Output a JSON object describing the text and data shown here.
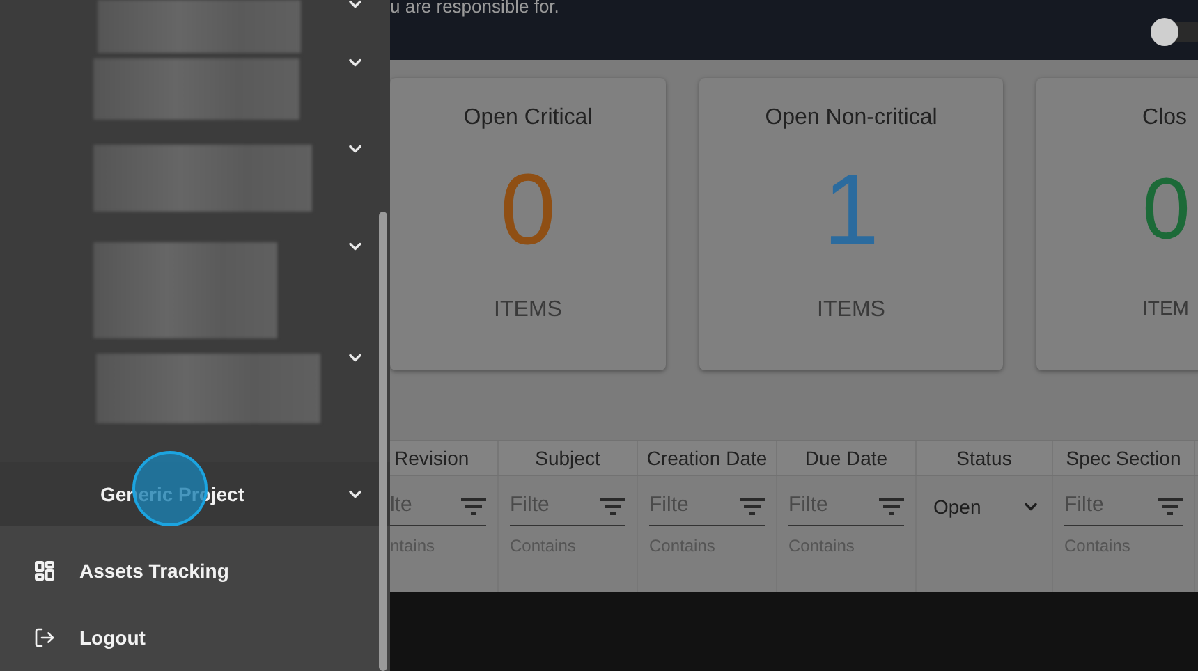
{
  "header": {
    "text": "u are responsible for.",
    "toggle": {
      "on": false
    }
  },
  "cards": [
    {
      "title": "Open Critical",
      "value": "0",
      "label": "ITEMS",
      "color": "#8f4f14"
    },
    {
      "title": "Open Non-critical",
      "value": "1",
      "label": "ITEMS",
      "color": "#2b6b9e"
    },
    {
      "title": "Clos",
      "value": "0",
      "label": "ITEM",
      "color": "#1c6a38"
    }
  ],
  "table": {
    "columns": [
      "Revision",
      "Subject",
      "Creation Date",
      "Due Date",
      "Status",
      "Spec Section"
    ],
    "filters": [
      {
        "kind": "text",
        "placeholder": "lte",
        "helper": "ntains"
      },
      {
        "kind": "text",
        "placeholder": "Filte",
        "helper": "Contains"
      },
      {
        "kind": "text",
        "placeholder": "Filte",
        "helper": "Contains"
      },
      {
        "kind": "text",
        "placeholder": "Filte",
        "helper": "Contains"
      },
      {
        "kind": "select",
        "value": "Open"
      },
      {
        "kind": "text",
        "placeholder": "Filte",
        "helper": "Contains"
      }
    ]
  },
  "sidebar": {
    "items": [
      {
        "kind": "redacted",
        "expanded": false
      },
      {
        "kind": "redacted",
        "expanded": false
      },
      {
        "kind": "redacted",
        "expanded": false
      },
      {
        "kind": "redacted",
        "expanded": false
      },
      {
        "kind": "redacted",
        "expanded": false
      },
      {
        "kind": "project",
        "label": "Generic Project",
        "expanded": false
      }
    ],
    "links": [
      {
        "label": "Assets Tracking"
      },
      {
        "label": "Logout"
      }
    ]
  }
}
